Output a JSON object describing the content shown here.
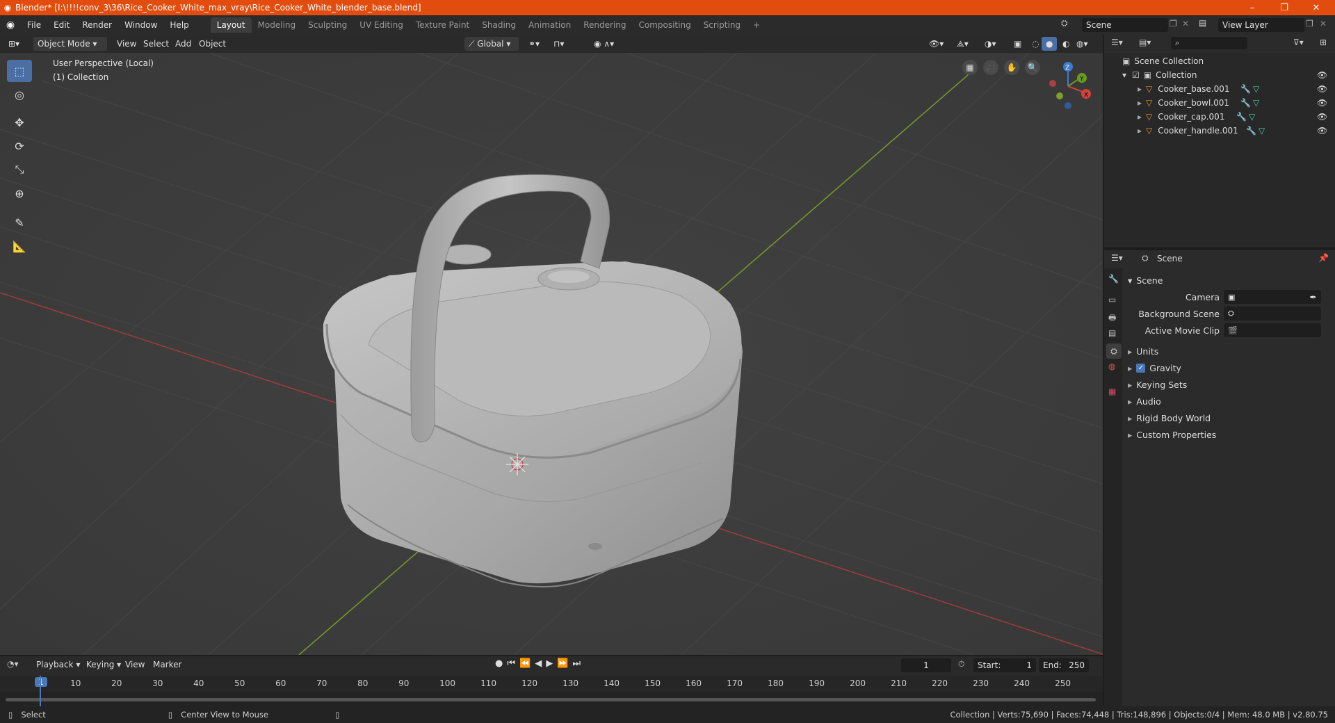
{
  "window": {
    "title": "Blender* [I:\\!!!!conv_3\\36\\Rice_Cooker_White_max_vray\\Rice_Cooker_White_blender_base.blend]",
    "minimize": "–",
    "restore": "❐",
    "close": "✕"
  },
  "menu": [
    "File",
    "Edit",
    "Render",
    "Window",
    "Help"
  ],
  "workspaces": [
    "Layout",
    "Modeling",
    "Sculpting",
    "UV Editing",
    "Texture Paint",
    "Shading",
    "Animation",
    "Rendering",
    "Compositing",
    "Scripting"
  ],
  "active_workspace": "Layout",
  "scene_field": "Scene",
  "view_layer_field": "View Layer",
  "viewport_header": {
    "mode": "Object Mode",
    "view": "View",
    "select": "Select",
    "add": "Add",
    "object": "Object",
    "transform_orientation": "Global"
  },
  "viewport": {
    "perspective": "User Perspective (Local)",
    "collection": "(1) Collection",
    "gizmo": {
      "x": "X",
      "y": "Y",
      "z": "Z"
    }
  },
  "outliner": {
    "root": "Scene Collection",
    "collection": "Collection",
    "objects": [
      "Cooker_base.001",
      "Cooker_bowl.001",
      "Cooker_cap.001",
      "Cooker_handle.001"
    ]
  },
  "properties": {
    "breadcrumb": "Scene",
    "section": "Scene",
    "camera_label": "Camera",
    "background_scene_label": "Background Scene",
    "active_movie_clip_label": "Active Movie Clip",
    "panels": [
      "Units",
      "Gravity",
      "Keying Sets",
      "Audio",
      "Rigid Body World",
      "Custom Properties"
    ],
    "gravity_enabled": true
  },
  "timeline": {
    "playback": "Playback",
    "keying": "Keying",
    "view": "View",
    "marker": "Marker",
    "current_frame": "1",
    "start_label": "Start:",
    "start": "1",
    "end_label": "End:",
    "end": "250",
    "ticks": [
      "1",
      "10",
      "20",
      "30",
      "40",
      "50",
      "60",
      "70",
      "80",
      "90",
      "100",
      "110",
      "120",
      "130",
      "140",
      "150",
      "160",
      "170",
      "180",
      "190",
      "200",
      "210",
      "220",
      "230",
      "240",
      "250"
    ]
  },
  "status": {
    "select": "Select",
    "center_view": "Center View to Mouse",
    "stats": "Collection | Verts:75,690 | Faces:74,448 | Tris:148,896 | Objects:0/4 | Mem: 48.0 MB | v2.80.75"
  },
  "colors": {
    "title_bar": "#e24d0f",
    "accent": "#4a6fa5",
    "object_icon": "#e0882a",
    "modifier_icon": "#5a9ad8",
    "mesh_icon": "#52c7a0"
  }
}
